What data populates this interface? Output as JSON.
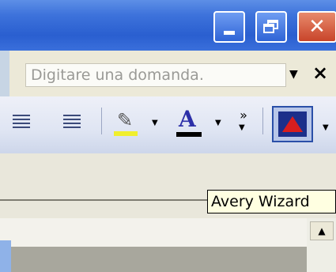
{
  "window": {
    "minimize_icon": "minimize-icon",
    "restore_icon": "restore-icon",
    "close_glyph": "✕"
  },
  "help": {
    "placeholder": "Digitare una domanda.",
    "dropdown_glyph": "▼",
    "close_glyph": "×"
  },
  "toolbar": {
    "more_glyph": "»",
    "dropdown_glyph": "▼",
    "font_color_letter": "A",
    "highlight_color": "#f0ef2e",
    "font_color": "#000000",
    "highlight_pen_glyph": "✎"
  },
  "tooltip": {
    "text": "Avery Wizard"
  },
  "scroll": {
    "up_glyph": "▲"
  }
}
